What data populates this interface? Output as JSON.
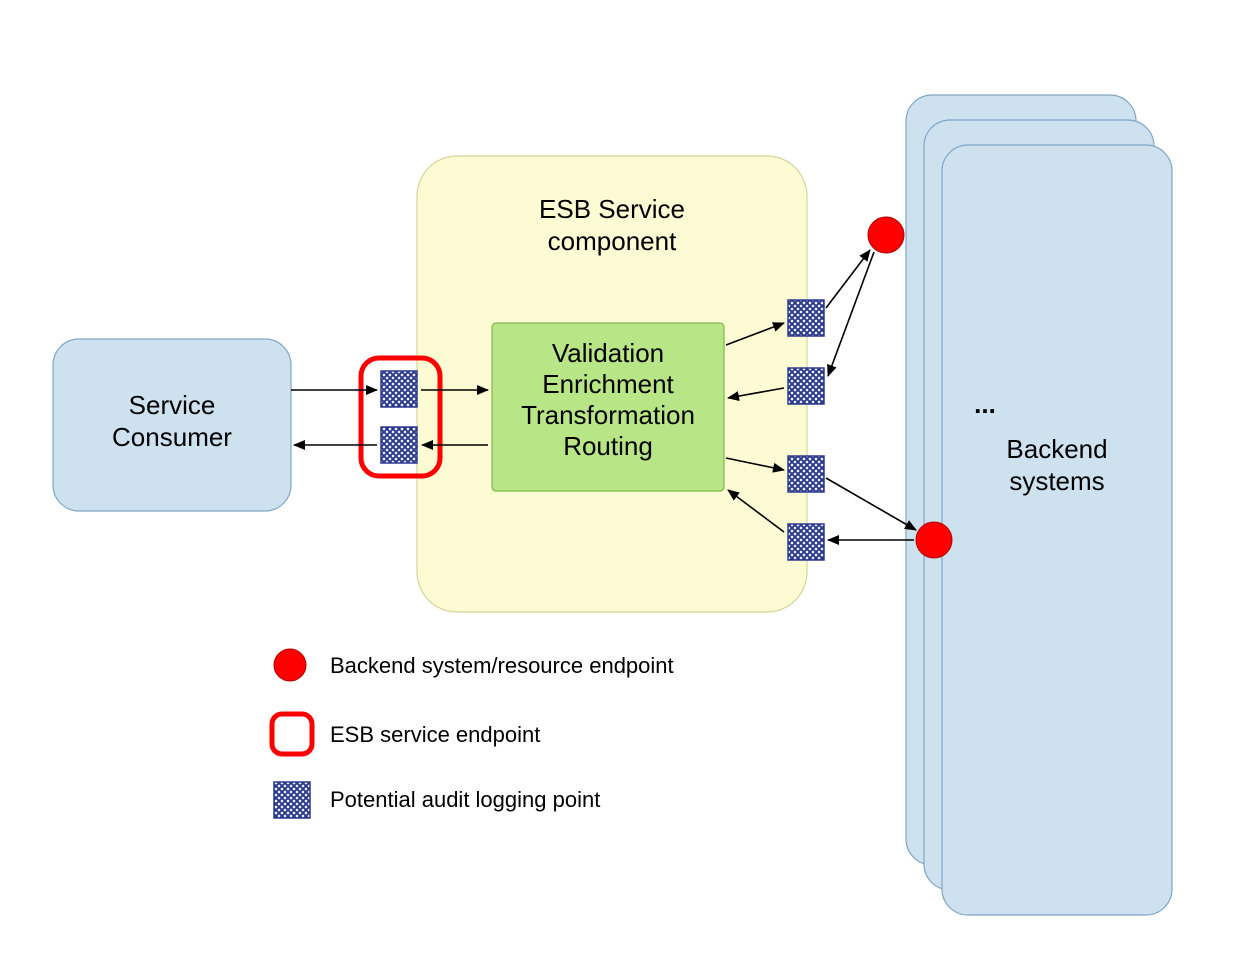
{
  "consumer": {
    "line1": "Service",
    "line2": "Consumer"
  },
  "esb": {
    "line1": "ESB Service",
    "line2": "component"
  },
  "vetr": {
    "l1": "Validation",
    "l2": "Enrichment",
    "l3": "Transformation",
    "l4": "Routing"
  },
  "backend": {
    "ellipsis": "...",
    "line1": "Backend",
    "line2": "systems"
  },
  "legend": {
    "dot": "Backend system/resource endpoint",
    "ring": "ESB service endpoint",
    "hatch": "Potential audit logging point"
  }
}
